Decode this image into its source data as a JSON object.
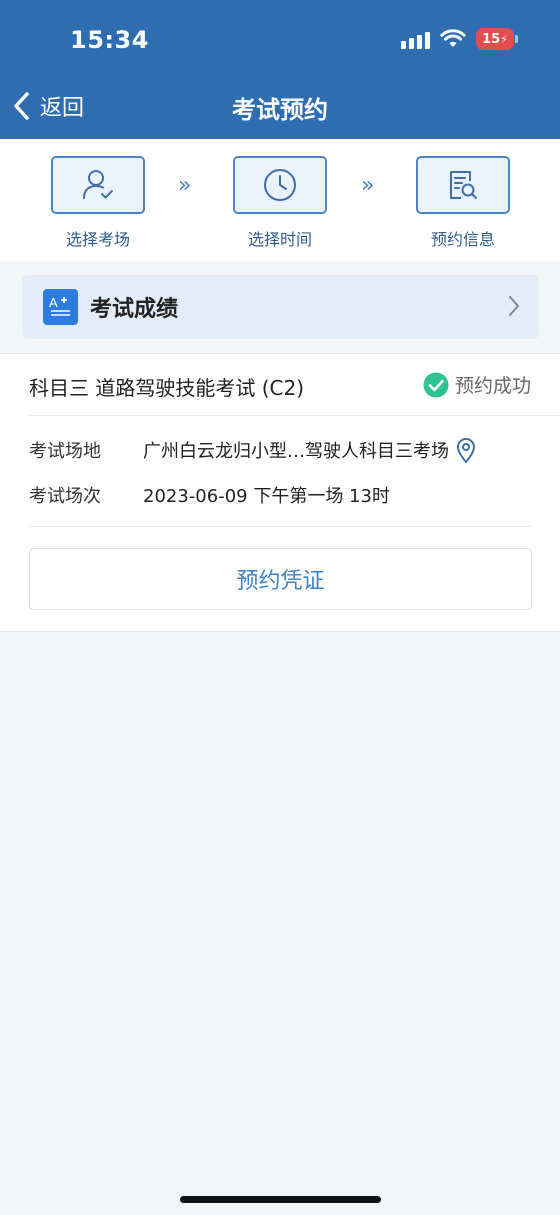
{
  "status_bar": {
    "time": "15:34",
    "battery": "15"
  },
  "nav": {
    "back_label": "返回",
    "title": "考试预约"
  },
  "steps": [
    {
      "label": "选择考场",
      "icon": "user-check-icon"
    },
    {
      "label": "选择时间",
      "icon": "clock-icon"
    },
    {
      "label": "预约信息",
      "icon": "document-search-icon"
    }
  ],
  "score": {
    "label": "考试成绩",
    "icon": "grade-icon"
  },
  "booking": {
    "subject": "科目三 道路驾驶技能考试 (C2)",
    "status": "预约成功",
    "venue_label": "考试场地",
    "venue_value": "广州白云龙归小型…驾驶人科目三考场",
    "session_label": "考试场次",
    "session_value": "2023-06-09 下午第一场 13时",
    "voucher_button": "预约凭证"
  },
  "colors": {
    "header": "#2f6db1",
    "accent": "#3b82c9",
    "success": "#2ec28f"
  }
}
